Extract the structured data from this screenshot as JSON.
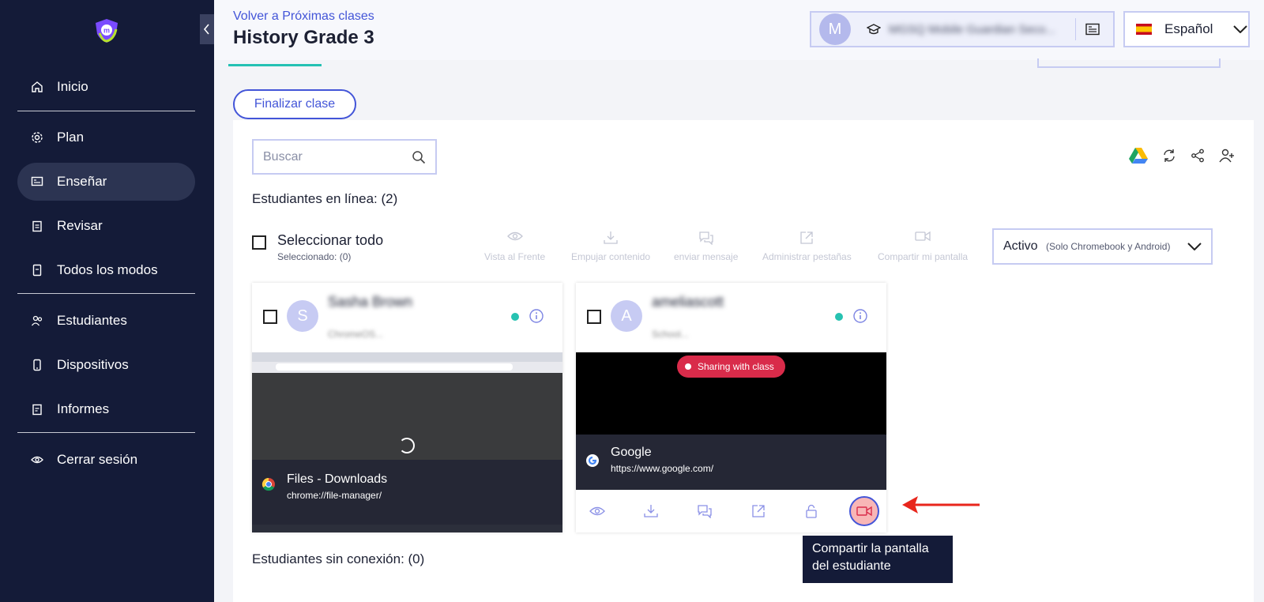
{
  "sidebar": {
    "items": [
      {
        "label": "Inicio",
        "icon": "home-icon"
      },
      {
        "label": "Plan",
        "icon": "gear-icon"
      },
      {
        "label": "Enseñar",
        "icon": "teach-icon"
      },
      {
        "label": "Revisar",
        "icon": "clipboard-icon"
      },
      {
        "label": "Todos los modos",
        "icon": "device-icon"
      },
      {
        "label": "Estudiantes",
        "icon": "students-icon"
      },
      {
        "label": "Dispositivos",
        "icon": "phone-icon"
      },
      {
        "label": "Informes",
        "icon": "report-icon"
      },
      {
        "label": "Cerrar sesión",
        "icon": "eye-icon"
      }
    ]
  },
  "header": {
    "back_link": "Volver a Próximas clases",
    "title": "History Grade 3",
    "school_initial": "M",
    "school_name": "MGSQ Mobile Guardian Seco...",
    "language": "Español"
  },
  "class": {
    "end_button": "Finalizar clase",
    "search_placeholder": "Buscar",
    "online_title": "Estudiantes en línea: (2)",
    "select_all": "Seleccionar todo",
    "selected_count": "Seleccionado: (0)",
    "bulk_actions": [
      "Vista al Frente",
      "Empujar contenido",
      "enviar mensaje",
      "Administrar pestañas",
      "Compartir mi pantalla"
    ],
    "filter": {
      "value": "Activo",
      "sub": "(Solo Chromebook y Android)"
    },
    "offline_title": "Estudiantes sin conexión: (0)"
  },
  "students": [
    {
      "initial": "S",
      "name": "Sasha Brown",
      "device": "ChromeOS...",
      "site_title": "Files - Downloads",
      "site_url": "chrome://file-manager/"
    },
    {
      "initial": "A",
      "name": "ameliascott",
      "device": "School...",
      "site_title": "Google",
      "site_url": "https://www.google.com/",
      "sharing_badge": "Sharing with class"
    }
  ],
  "tooltip": "Compartir la pantalla del estudiante",
  "colors": {
    "sidebar": "#141b38",
    "accent": "#4355d8",
    "online": "#27c2b1",
    "sharing": "#d92b4a",
    "arrow": "#e8261c"
  }
}
